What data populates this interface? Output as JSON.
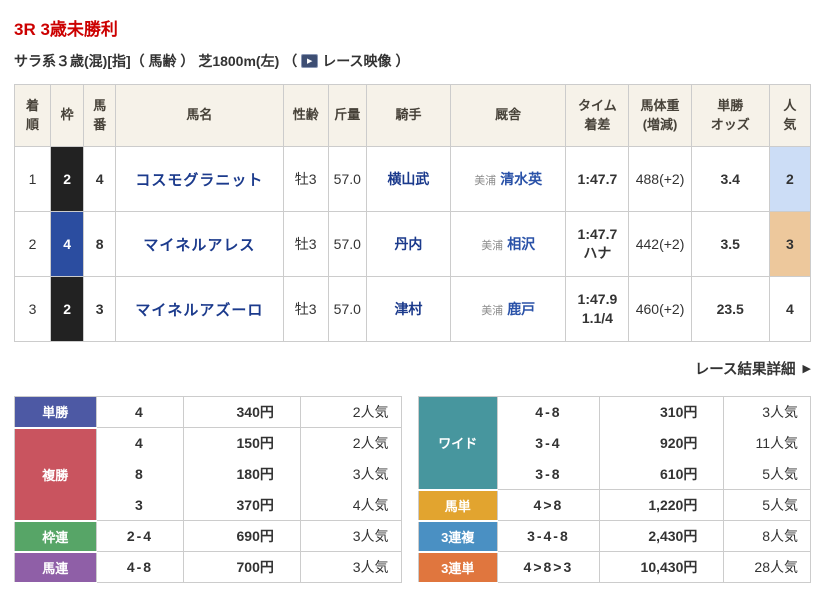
{
  "header": {
    "race_title": "3R 3歳未勝利",
    "race_conditions": "サラ系３歳(混)[指]（ 馬齢 ） 芝1800m(左)",
    "paren_open": "（",
    "paren_close": "）",
    "video_link": "レース映像",
    "video_icon_glyph": "▶"
  },
  "results": {
    "columns": {
      "pos": "着\n順",
      "frame": "枠",
      "num": "馬\n番",
      "name": "馬名",
      "sexage": "性齢",
      "weight": "斤量",
      "jockey": "騎手",
      "stable": "厩舎",
      "time": "タイム\n着差",
      "hweight": "馬体重\n(増減)",
      "odds": "単勝\nオッズ",
      "pop": "人\n気"
    },
    "rows": [
      {
        "pos": "1",
        "frame": "2",
        "frame_color": "#222222",
        "num": "4",
        "name": "コスモグラニット",
        "sexage": "牡3",
        "weight": "57.0",
        "jockey": "横山武",
        "region": "美浦",
        "trainer": "清水英",
        "time": "1:47.7",
        "margin": "",
        "hweight": "488(+2)",
        "odds": "3.4",
        "pop": "2",
        "pop_bg": "#ccddf6"
      },
      {
        "pos": "2",
        "frame": "4",
        "frame_color": "#2b4da0",
        "num": "8",
        "name": "マイネルアレス",
        "sexage": "牡3",
        "weight": "57.0",
        "jockey": "丹内",
        "region": "美浦",
        "trainer": "相沢",
        "time": "1:47.7",
        "margin": "ハナ",
        "hweight": "442(+2)",
        "odds": "3.5",
        "pop": "3",
        "pop_bg": "#edc89c"
      },
      {
        "pos": "3",
        "frame": "2",
        "frame_color": "#222222",
        "num": "3",
        "name": "マイネルアズーロ",
        "sexage": "牡3",
        "weight": "57.0",
        "jockey": "津村",
        "region": "美浦",
        "trainer": "鹿戸",
        "time": "1:47.9",
        "margin": "1.1/4",
        "hweight": "460(+2)",
        "odds": "23.5",
        "pop": "4",
        "pop_bg": ""
      }
    ]
  },
  "details_link": {
    "label": "レース結果詳細",
    "arrow": "▶"
  },
  "payouts": {
    "left": [
      {
        "label": "単勝",
        "color": "#4d59a4",
        "rows": [
          {
            "combo": "4",
            "payout": "340円",
            "pop": "2人気"
          }
        ]
      },
      {
        "label": "複勝",
        "color": "#c9545f",
        "rows": [
          {
            "combo": "4",
            "payout": "150円",
            "pop": "2人気"
          },
          {
            "combo": "8",
            "payout": "180円",
            "pop": "3人気"
          },
          {
            "combo": "3",
            "payout": "370円",
            "pop": "4人気"
          }
        ]
      },
      {
        "label": "枠連",
        "color": "#57a567",
        "rows": [
          {
            "combo": "2-4",
            "payout": "690円",
            "pop": "3人気"
          }
        ]
      },
      {
        "label": "馬連",
        "color": "#8f5fa7",
        "rows": [
          {
            "combo": "4-8",
            "payout": "700円",
            "pop": "3人気"
          }
        ]
      }
    ],
    "right": [
      {
        "label": "ワイド",
        "color": "#47969e",
        "rows": [
          {
            "combo": "4-8",
            "payout": "310円",
            "pop": "3人気"
          },
          {
            "combo": "3-4",
            "payout": "920円",
            "pop": "11人気"
          },
          {
            "combo": "3-8",
            "payout": "610円",
            "pop": "5人気"
          }
        ]
      },
      {
        "label": "馬単",
        "color": "#e2a42f",
        "rows": [
          {
            "combo": "4>8",
            "payout": "1,220円",
            "pop": "5人気"
          }
        ]
      },
      {
        "label": "3連複",
        "color": "#4a90c3",
        "rows": [
          {
            "combo": "3-4-8",
            "payout": "2,430円",
            "pop": "8人気"
          }
        ]
      },
      {
        "label": "3連単",
        "color": "#e0763e",
        "rows": [
          {
            "combo": "4>8>3",
            "payout": "10,430円",
            "pop": "28人気"
          }
        ]
      }
    ]
  }
}
